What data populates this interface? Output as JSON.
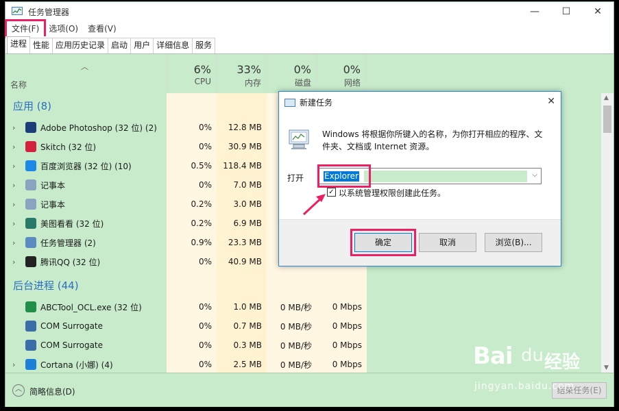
{
  "window": {
    "title": "任务管理器",
    "min_glyph": "—",
    "max_glyph": "☐",
    "close_glyph": "✕"
  },
  "menu": [
    "文件(F)",
    "选项(O)",
    "查看(V)"
  ],
  "tabs": [
    "进程",
    "性能",
    "应用历史记录",
    "启动",
    "用户",
    "详细信息",
    "服务"
  ],
  "columns": {
    "name": "名称",
    "cpu": {
      "pct": "6%",
      "label": "CPU"
    },
    "mem": {
      "pct": "33%",
      "label": "内存"
    },
    "disk": {
      "pct": "0%",
      "label": "磁盘"
    },
    "net": {
      "pct": "0%",
      "label": "网络"
    }
  },
  "groups": {
    "apps": "应用 (8)",
    "background": "后台进程 (44)"
  },
  "apps": [
    {
      "name": "Adobe Photoshop (32 位) (2)",
      "cpu": "0%",
      "mem": "12.8 MB",
      "icon": "photoshop-icon",
      "color": "#1b3d78"
    },
    {
      "name": "Skitch (32 位)",
      "cpu": "0%",
      "mem": "30.9 MB",
      "icon": "skitch-icon",
      "color": "#d4213d"
    },
    {
      "name": "百度浏览器 (32 位) (10)",
      "cpu": "0.5%",
      "mem": "118.4 MB",
      "icon": "browser-icon",
      "color": "#1e88e5"
    },
    {
      "name": "记事本",
      "cpu": "0%",
      "mem": "7.0 MB",
      "icon": "notepad-icon",
      "color": "#8aa4c0"
    },
    {
      "name": "记事本",
      "cpu": "0.2%",
      "mem": "3.0 MB",
      "icon": "notepad-icon",
      "color": "#8aa4c0"
    },
    {
      "name": "美图看看 (32 位)",
      "cpu": "0.2%",
      "mem": "6.9 MB",
      "icon": "viewer-icon",
      "color": "#2a7a6a"
    },
    {
      "name": "任务管理器 (2)",
      "cpu": "0.9%",
      "mem": "23.3 MB",
      "icon": "taskmgr-icon",
      "color": "#5b8bc0"
    },
    {
      "name": "腾讯QQ (32 位)",
      "cpu": "0%",
      "mem": "40.9 MB",
      "icon": "qq-icon",
      "color": "#222222"
    }
  ],
  "background": [
    {
      "name": "ABCTool_OCL.exe (32 位)",
      "cpu": "0%",
      "mem": "1.0 MB",
      "disk": "0 MB/秒",
      "net": "0 Mbps",
      "icon": "abctool-icon",
      "color": "#1f8f4a",
      "expand": false
    },
    {
      "name": "COM Surrogate",
      "cpu": "0%",
      "mem": "0.7 MB",
      "disk": "0 MB/秒",
      "net": "0 Mbps",
      "icon": "com-icon",
      "color": "#3b6ea8",
      "expand": false
    },
    {
      "name": "COM Surrogate",
      "cpu": "0%",
      "mem": "0.3 MB",
      "disk": "0 MB/秒",
      "net": "0 Mbps",
      "icon": "com-icon",
      "color": "#3b6ea8",
      "expand": false
    },
    {
      "name": "Cortana (小娜) (4)",
      "cpu": "0%",
      "mem": "2.5 MB",
      "disk": "0 MB/秒",
      "net": "0 Mbps",
      "icon": "cortana-icon",
      "color": "#1e7fd6",
      "expand": true
    }
  ],
  "footer": {
    "fewer": "简略信息(D)",
    "end_task": "结束任务(E)"
  },
  "dialog": {
    "title": "新建任务",
    "message": "Windows 将根据你所键入的名称，为你打开相应的程序、文件夹、文档或 Internet 资源。",
    "open_label": "打开",
    "input_value": "Explorer",
    "admin_checkbox": "以系统管理权限创建此任务。",
    "admin_checked": true,
    "ok": "确定",
    "cancel": "取消",
    "browse": "浏览(B)..."
  },
  "watermark": {
    "main": "Bai",
    "paw": "du",
    "cn": "经验",
    "sub": "jingyan.baidu.com"
  },
  "colors": {
    "highlight": "#ec1f64",
    "accent": "#2a6fc0",
    "selection": "#0078d7"
  }
}
